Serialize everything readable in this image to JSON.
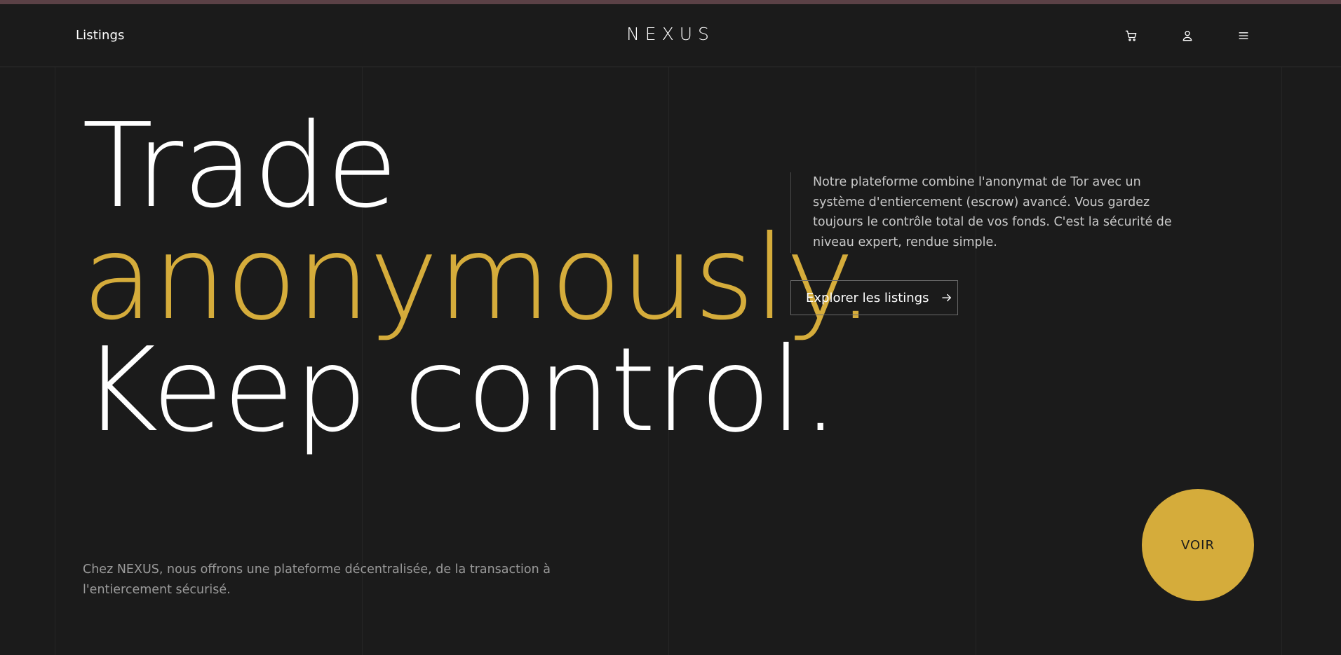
{
  "header": {
    "nav_link": "Listings",
    "logo": "NEXUS",
    "icons": [
      "cart-icon",
      "user-icon",
      "menu-icon"
    ]
  },
  "hero": {
    "line1": "Trade",
    "line2": "anonymously.",
    "line3": "Keep control.",
    "accent_color": "#d5ac3b"
  },
  "blurb": {
    "text": "Notre plateforme combine l'anonymat de Tor avec un système d'entiercement (escrow) avancé. Vous gardez toujours le contrôle total de vos fonds. C'est la sécurité de niveau expert, rendue simple."
  },
  "cta": {
    "label": "Explorer les listings",
    "icon": "arrow-right-icon"
  },
  "footer": {
    "text": "Chez NEXUS, nous offrons une plateforme décentralisée, de la transaction à l'entiercement sécurisé."
  },
  "voir_button": {
    "label": "VOIR"
  },
  "colors": {
    "background": "#1b1b1b",
    "text": "#ffffff",
    "muted_text": "#9a9a9a"
  }
}
